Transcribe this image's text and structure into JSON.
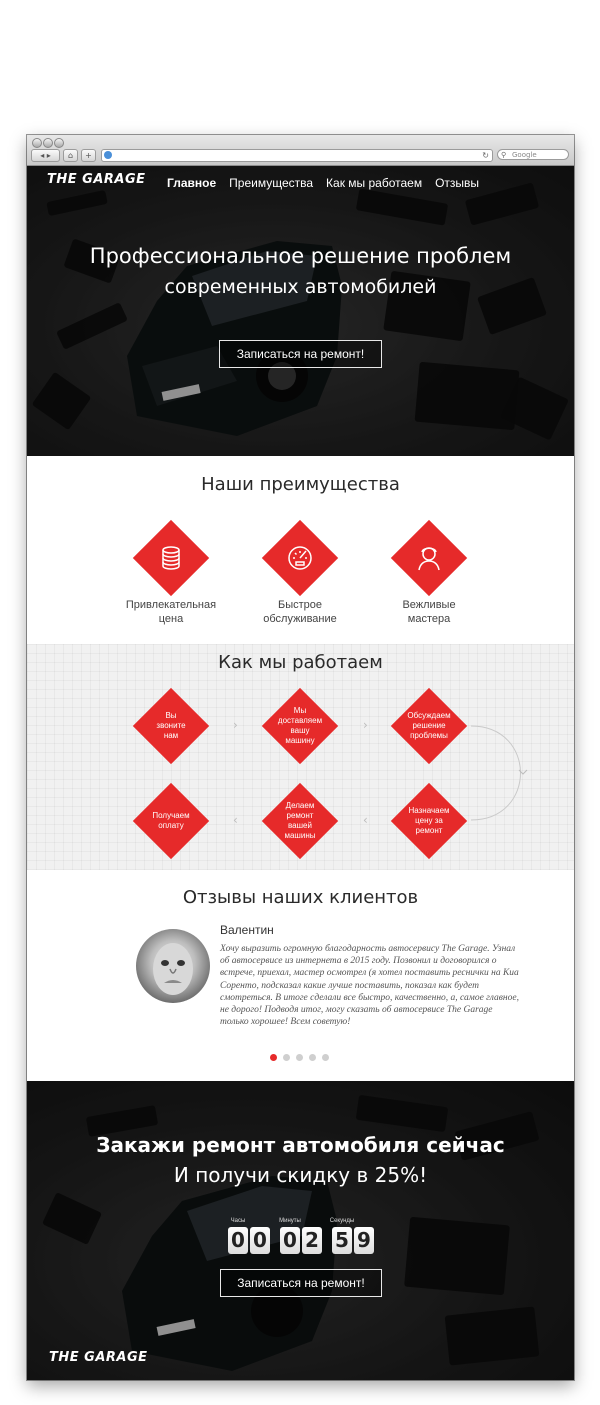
{
  "browser": {
    "search_placeholder": "Google",
    "back_label": "◂ ▸",
    "home_label": "⌂",
    "add_label": "+",
    "reload_label": "↻"
  },
  "header": {
    "logo": "THE GARAGE",
    "nav": [
      "Главное",
      "Преимущества",
      "Как мы работаем",
      "Отзывы"
    ]
  },
  "hero": {
    "title_line1": "Профессиональное решение проблем",
    "title_line2": "современных автомобилей",
    "cta_label": "Записаться на ремонт!"
  },
  "advantages": {
    "title": "Наши преимущества",
    "items": [
      {
        "label_line1": "Привлекательная",
        "label_line2": "цена",
        "icon": "coins-icon"
      },
      {
        "label_line1": "Быстрое",
        "label_line2": "обслуживание",
        "icon": "speedometer-icon"
      },
      {
        "label_line1": "Вежливые",
        "label_line2": "мастера",
        "icon": "worker-icon"
      }
    ]
  },
  "how": {
    "title": "Как мы работаем",
    "steps": [
      {
        "text": "Вы звоните нам"
      },
      {
        "text": "Мы доставляем вашу машину"
      },
      {
        "text": "Обсуждаем решение проблемы"
      },
      {
        "text": "Назначаем цену за ремонт"
      },
      {
        "text": "Делаем ремонт вашей машины"
      },
      {
        "text": "Получаем оплату"
      }
    ]
  },
  "reviews": {
    "title": "Отзывы наших клиентов",
    "name": "Валентин",
    "text": "Хочу выразить огромную благодарность автосервису The Garage. Узнал об автосервисе из интернета в 2015 году. Позвонил и договорился о встрече, приехал, мастер осмотрел (я хотел поставить реснички на Киа Соренто, подсказал какие лучше поставить, показал как будет смотреться. В итоге сделали все быстро, качественно, а, самое главное, не дорого! Подводя итог, могу сказать об автосервисе The Garage только хорошее! Всем советую!",
    "slides": 5,
    "active_slide": 1
  },
  "cta": {
    "title_line1": "Закажи ремонт автомобиля сейчас",
    "title_line2": "И получи скидку в 25%!",
    "timer_labels": [
      "Часы",
      "Минуты",
      "Секунды"
    ],
    "timer_digits": [
      "0",
      "0",
      "0",
      "2",
      "5",
      "9"
    ],
    "button_label": "Записаться на ремонт!",
    "logo": "THE GARAGE"
  },
  "colors": {
    "accent": "#e62a2a",
    "dark": "#1c1c1c"
  }
}
